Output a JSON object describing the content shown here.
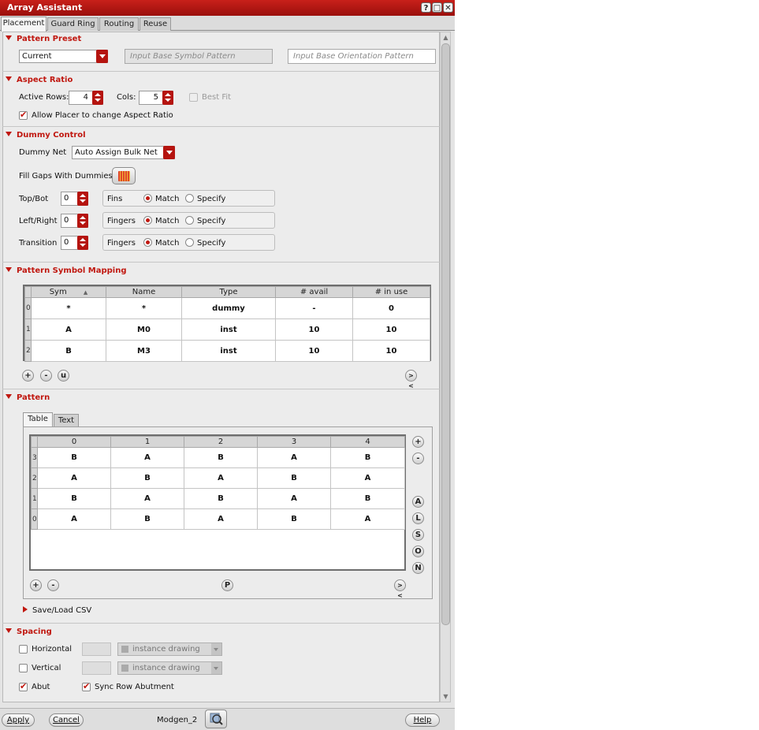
{
  "window": {
    "title": "Array Assistant",
    "title_buttons": [
      "?",
      "□",
      "✕"
    ]
  },
  "tabs": [
    {
      "label": "Placement",
      "active": true
    },
    {
      "label": "Guard Ring",
      "active": false
    },
    {
      "label": "Routing",
      "active": false
    },
    {
      "label": "Reuse",
      "active": false
    }
  ],
  "pattern_preset": {
    "header": "Pattern Preset",
    "preset_value": "Current",
    "base_symbol_placeholder": "Input Base Symbol Pattern",
    "base_orientation_placeholder": "Input Base Orientation Pattern"
  },
  "aspect_ratio": {
    "header": "Aspect Ratio",
    "active_rows_label": "Active Rows:",
    "active_rows_value": "4",
    "cols_label": "Cols:",
    "cols_value": "5",
    "best_fit_label": "Best Fit",
    "best_fit_checked": false,
    "allow_placer_label": "Allow Placer to change Aspect Ratio",
    "allow_placer_checked": true
  },
  "dummy_control": {
    "header": "Dummy Control",
    "dummy_net_label": "Dummy Net",
    "dummy_net_value": "Auto Assign Bulk Net",
    "fill_gaps_label": "Fill Gaps With Dummies",
    "rows": [
      {
        "label": "Top/Bot",
        "value": "0",
        "unit": "Fins",
        "match": "Match",
        "specify": "Specify"
      },
      {
        "label": "Left/Right",
        "value": "0",
        "unit": "Fingers",
        "match": "Match",
        "specify": "Specify"
      },
      {
        "label": "Transition",
        "value": "0",
        "unit": "Fingers",
        "match": "Match",
        "specify": "Specify"
      }
    ]
  },
  "symbol_mapping": {
    "header": "Pattern Symbol Mapping",
    "columns": [
      "Sym",
      "Name",
      "Type",
      "# avail",
      "# in use"
    ],
    "rows": [
      {
        "index": "0",
        "sym": "*",
        "name": "*",
        "type": "dummy",
        "avail": "-",
        "in_use": "0"
      },
      {
        "index": "1",
        "sym": "A",
        "name": "M0",
        "type": "inst",
        "avail": "10",
        "in_use": "10"
      },
      {
        "index": "2",
        "sym": "B",
        "name": "M3",
        "type": "inst",
        "avail": "10",
        "in_use": "10"
      }
    ],
    "buttons": [
      "+",
      "-",
      "u"
    ],
    "collapse_button": "><"
  },
  "pattern": {
    "header": "Pattern",
    "subtabs": [
      {
        "label": "Table",
        "active": true
      },
      {
        "label": "Text",
        "active": false
      }
    ],
    "columns": [
      "0",
      "1",
      "2",
      "3",
      "4"
    ],
    "rows": [
      {
        "index": "3",
        "cells": [
          "B",
          "A",
          "B",
          "A",
          "B"
        ]
      },
      {
        "index": "2",
        "cells": [
          "A",
          "B",
          "A",
          "B",
          "A"
        ]
      },
      {
        "index": "1",
        "cells": [
          "B",
          "A",
          "B",
          "A",
          "B"
        ]
      },
      {
        "index": "0",
        "cells": [
          "A",
          "B",
          "A",
          "B",
          "A"
        ]
      }
    ],
    "side_buttons": [
      "+",
      "-",
      "A",
      "L",
      "S",
      "O",
      "N"
    ],
    "bottom_buttons": [
      "+",
      "-"
    ],
    "p_button": "P",
    "collapse_button": "><",
    "save_load_label": "Save/Load CSV"
  },
  "spacing": {
    "header": "Spacing",
    "horizontal_label": "Horizontal",
    "horizontal_checked": false,
    "horizontal_mode": "instance drawing",
    "vertical_label": "Vertical",
    "vertical_checked": false,
    "vertical_mode": "instance drawing",
    "abut_label": "Abut",
    "abut_checked": true,
    "sync_label": "Sync Row Abutment",
    "sync_checked": true
  },
  "footer": {
    "apply": "Apply",
    "cancel": "Cancel",
    "cell_name": "Modgen_2",
    "help": "Help"
  }
}
